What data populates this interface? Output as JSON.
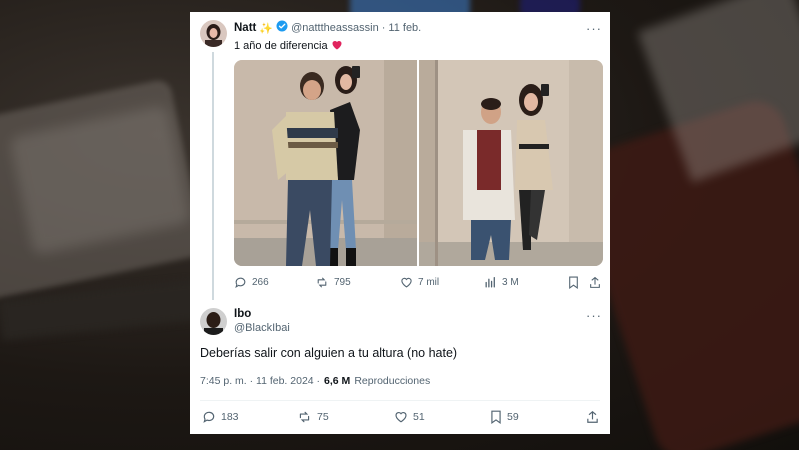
{
  "tweet": {
    "author_name": "Natt",
    "author_handle": "@natttheassassin",
    "date": "· 11 feb.",
    "text": "1 año de diferencia",
    "stats": {
      "replies": "266",
      "retweets": "795",
      "likes": "7 mil",
      "views": "3 M"
    }
  },
  "reply": {
    "author_name": "Ibo",
    "author_handle": "@BlackIbai",
    "text": "Deberías salir con alguien a tu altura (no hate)",
    "timestamp": "7:45 p. m. · 11 feb. 2024 ·",
    "views_count": "6,6 M",
    "views_label": "Reproducciones",
    "stats": {
      "replies": "183",
      "retweets": "75",
      "likes": "51",
      "bookmarks": "59"
    }
  },
  "colors": {
    "verified": "#1d9bf0",
    "heart": "#e0245e",
    "muted": "#536471",
    "sparkle": "#f4b400"
  },
  "icons": [
    "verified-badge-icon",
    "sparkle-icon",
    "heart-emoji-icon",
    "reply-icon",
    "retweet-icon",
    "like-icon",
    "views-icon",
    "bookmark-icon",
    "share-icon",
    "more-options-icon"
  ]
}
